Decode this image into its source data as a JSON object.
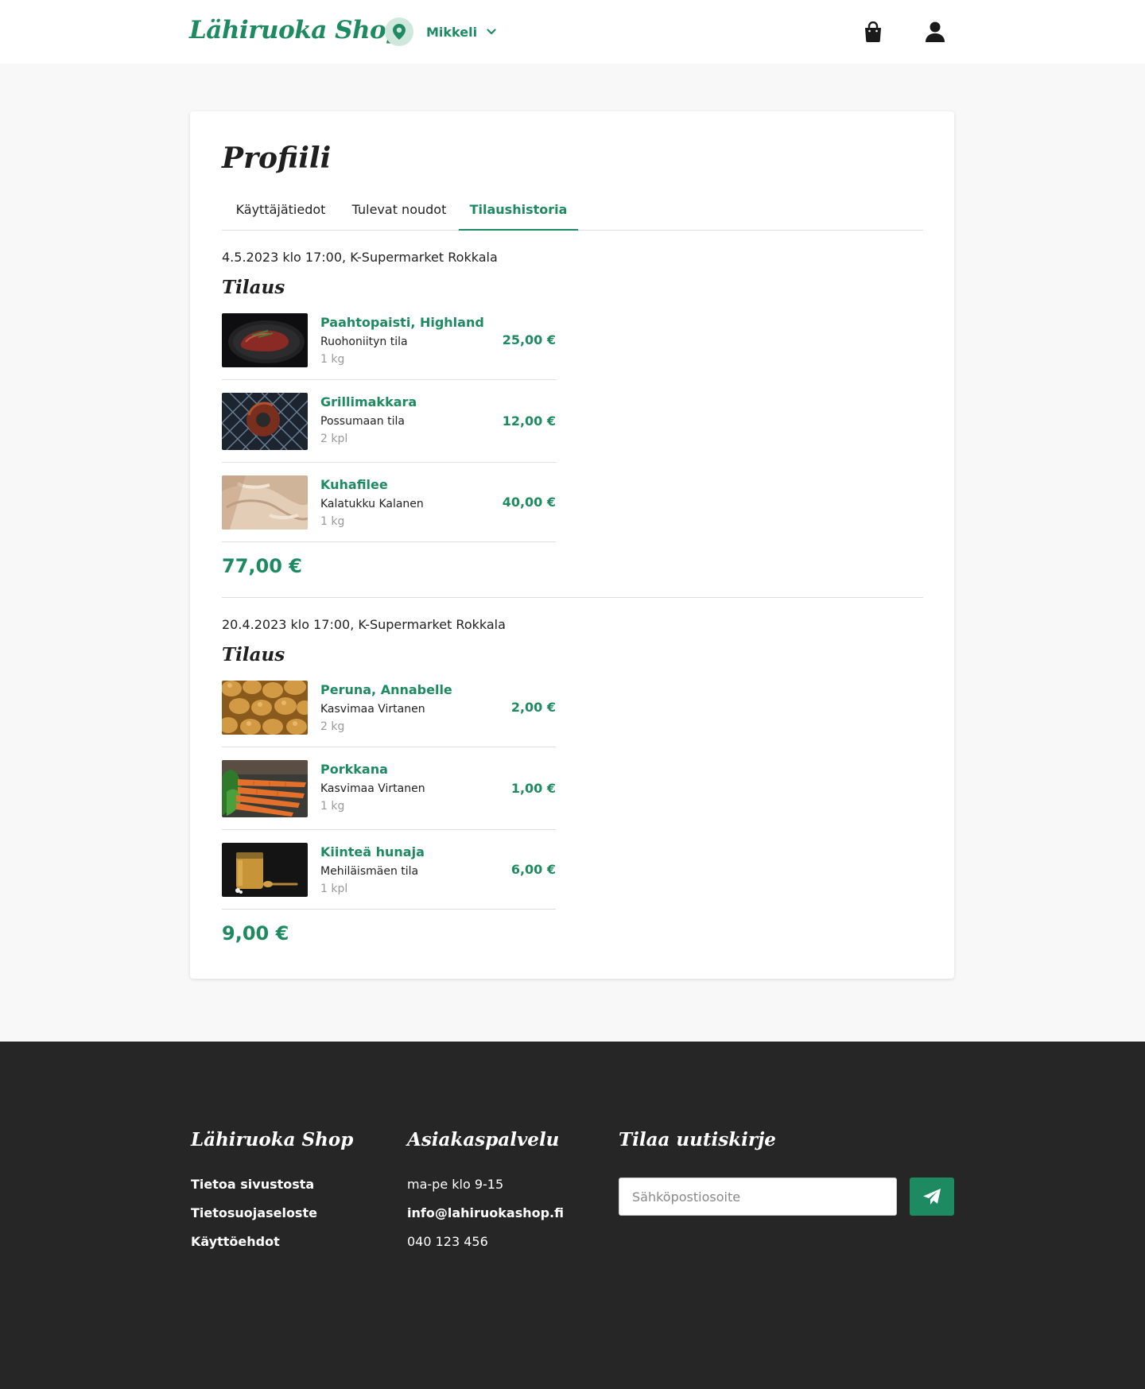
{
  "header": {
    "logo": "Lähiruoka Shop",
    "location": "Mikkeli",
    "icons": [
      "location-pin-icon",
      "chevron-down-icon",
      "shopping-bag-icon",
      "user-icon"
    ]
  },
  "profile": {
    "title": "Profiili",
    "tabs": [
      {
        "label": "Käyttäjätiedot",
        "active": false
      },
      {
        "label": "Tulevat noudot",
        "active": false
      },
      {
        "label": "Tilaushistoria",
        "active": true
      }
    ]
  },
  "orders": [
    {
      "meta": "4.5.2023 klo 17:00, K-Supermarket Rokkala",
      "heading": "Tilaus",
      "items": [
        {
          "name": "Paahtopaisti, Highland",
          "farm": "Ruohoniityn tila",
          "qty": "1 kg",
          "price": "25,00 €",
          "image": "steak-photo"
        },
        {
          "name": "Grillimakkara",
          "farm": "Possumaan tila",
          "qty": "2 kpl",
          "price": "12,00 €",
          "image": "sausage-photo"
        },
        {
          "name": "Kuhafilee",
          "farm": "Kalatukku Kalanen",
          "qty": "1 kg",
          "price": "40,00 €",
          "image": "fish-fillet-photo"
        }
      ],
      "total": "77,00 €"
    },
    {
      "meta": "20.4.2023 klo 17:00, K-Supermarket Rokkala",
      "heading": "Tilaus",
      "items": [
        {
          "name": "Peruna, Annabelle",
          "farm": "Kasvimaa Virtanen",
          "qty": "2 kg",
          "price": "2,00 €",
          "image": "potatoes-photo"
        },
        {
          "name": "Porkkana",
          "farm": "Kasvimaa Virtanen",
          "qty": "1 kg",
          "price": "1,00 €",
          "image": "carrots-photo"
        },
        {
          "name": "Kiinteä hunaja",
          "farm": "Mehiläismäen tila",
          "qty": "1 kpl",
          "price": "6,00 €",
          "image": "honey-jar-photo"
        }
      ],
      "total": "9,00 €"
    }
  ],
  "footer": {
    "brand": {
      "heading": "Lähiruoka Shop",
      "links": [
        "Tietoa sivustosta",
        "Tietosuojaseloste",
        "Käyttöehdot"
      ]
    },
    "service": {
      "heading": "Asiakaspalvelu",
      "hours": "ma-pe klo 9-15",
      "email": "info@lahiruokashop.fi",
      "phone": "040 123 456"
    },
    "newsletter": {
      "heading": "Tilaa uutiskirje",
      "placeholder": "Sähköpostiosoite",
      "value": "",
      "button_icon": "send-icon"
    }
  },
  "colors": {
    "brand_green": "#1e8a62",
    "page_bg": "#f8f8f8",
    "footer_bg": "#262626"
  }
}
